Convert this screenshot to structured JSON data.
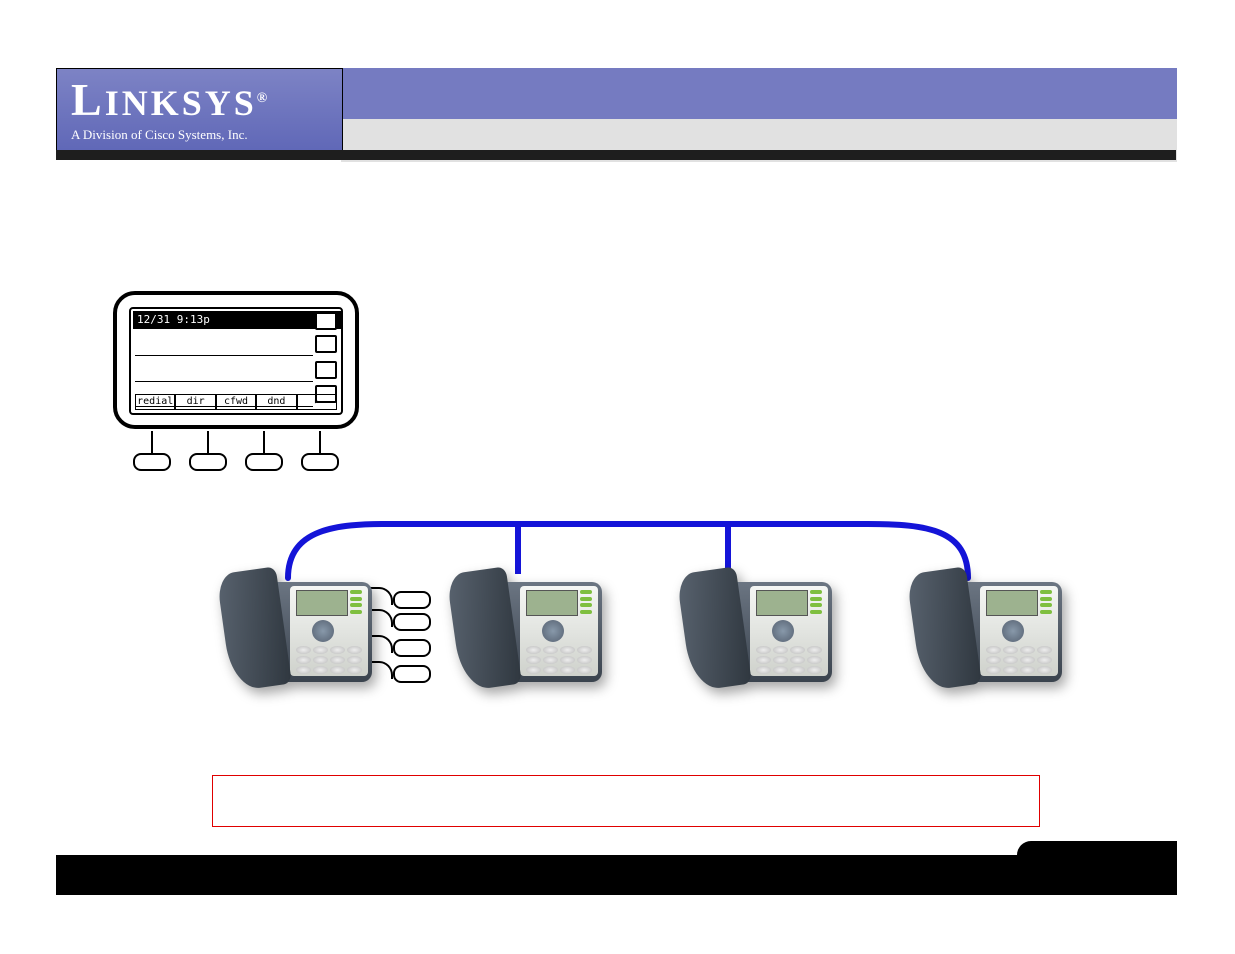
{
  "header": {
    "brand_prefix": "L",
    "brand_rest": "INKSYS",
    "registered": "®",
    "subtitle": "A Division of Cisco Systems, Inc."
  },
  "lcd": {
    "datetime": "12/31 9:13p",
    "softkeys": [
      "redial",
      "dir",
      "cfwd",
      "dnd",
      "▸"
    ]
  },
  "diagram": {
    "phone_count": 4
  }
}
